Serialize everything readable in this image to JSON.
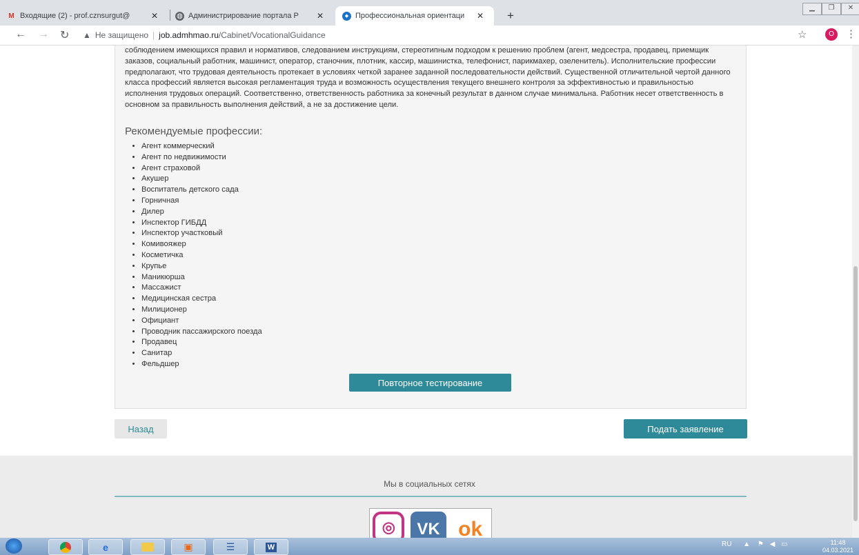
{
  "browser": {
    "tabs": [
      {
        "title": "Входящие (2) - prof.cznsurgut@",
        "favicon": "gmail-icon"
      },
      {
        "title": "Администрирование портала Р",
        "favicon": "globe-icon"
      },
      {
        "title": "Профессиональная ориентаци",
        "favicon": "site-icon"
      }
    ],
    "close_glyph": "✕",
    "new_tab_glyph": "+",
    "security_label": "Не защищено",
    "url_domain": "job.admhmao.ru",
    "url_path": "/Cabinet/VocationalGuidance",
    "profile_initial": "O"
  },
  "content": {
    "description": "соблюдением имеющихся правил и нормативов, следованием инструкциям, стереотипным подходом к решению проблем (агент, медсестра, продавец, приемщик заказов, социальный работник, машинист, оператор, станочник, плотник, кассир, машинистка, телефонист, парикмахер, озеленитель). Исполнительские профессии предполагают, что трудовая деятельность протекает в условиях четкой заранее заданной последовательности действий. Существенной отличительной чертой данного класса профессий является высокая регламентация труда и возможность осуществления текущего внешнего контроля за эффективностью и правильностью исполнения трудовых операций. Соответственно, ответственность работника за конечный результат в данном случае минимальна. Работник несет ответственность в основном за правильность выполнения действий, а не за достижение цели.",
    "recommended_title": "Рекомендуемые профессии:",
    "professions": [
      "Агент коммерческий",
      "Агент по недвижимости",
      "Агент страховой",
      "Акушер",
      "Воспитатель детского сада",
      "Горничная",
      "Дилер",
      "Инспектор ГИБДД",
      "Инспектор участковый",
      "Комивояжер",
      "Косметичка",
      "Крупье",
      "Маникюрша",
      "Массажист",
      "Медицинская сестра",
      "Милиционер",
      "Официант",
      "Проводник пассажирского поезда",
      "Продавец",
      "Санитар",
      "Фельдшер"
    ],
    "retest_label": "Повторное тестирование",
    "back_label": "Назад",
    "apply_label": "Подать заявление"
  },
  "footer": {
    "social_title": "Мы в социальных сетях",
    "vk_label": "VK",
    "ok_label": "ok"
  },
  "taskbar": {
    "language": "RU",
    "time": "11:48",
    "date": "04.03.2021"
  },
  "colors": {
    "accent": "#2e8a98",
    "panel_bg": "#f5f5f5",
    "footer_bg": "#ececec"
  }
}
